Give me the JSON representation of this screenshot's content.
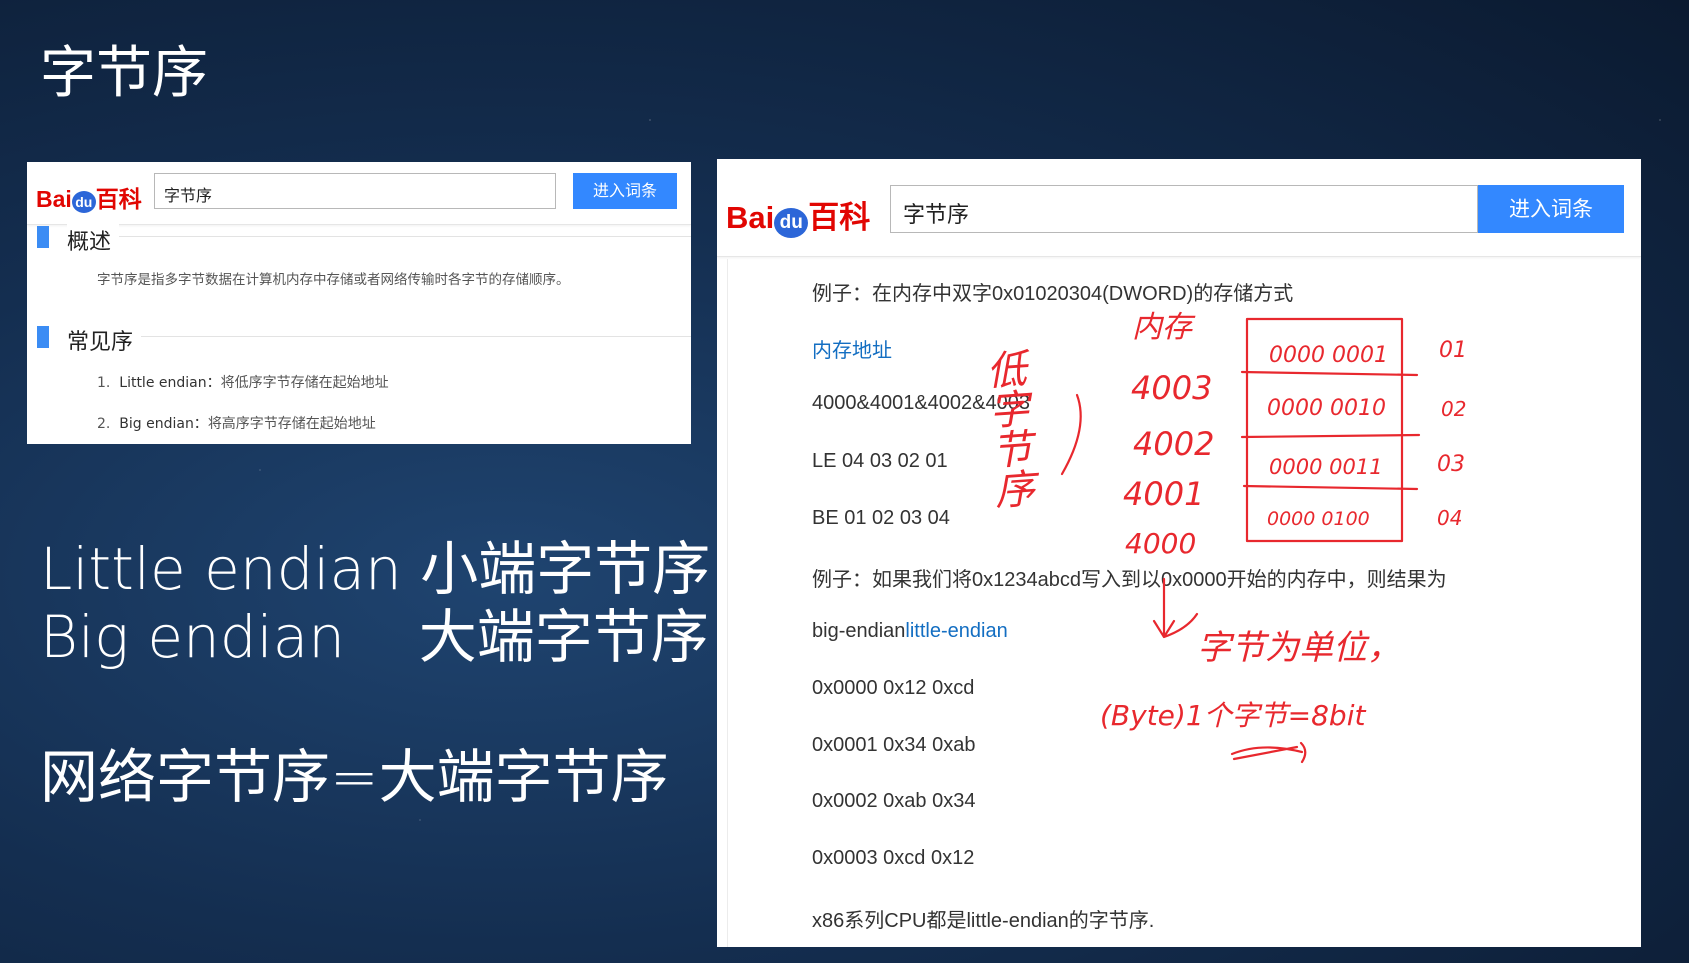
{
  "slide": {
    "title": "字节序",
    "line1": "Little endian 小端字节序",
    "line2": "Big endian    大端字节序",
    "line3": "网络字节序=大端字节序"
  },
  "brand": {
    "bai": "Bai",
    "du": "du",
    "baike": "百科",
    "red": "#e10602",
    "blue": "#3388ff"
  },
  "small_panel": {
    "search_value": "字节序",
    "enter_button": "进入词条",
    "overview_title": "概述",
    "overview_text": "字节序是指多字节数据在计算机内存中存储或者网络传输时各字节的存储顺序。",
    "common_title": "常见序",
    "items": [
      {
        "num": "1.",
        "name": "Little endian：",
        "desc": "将低序字节存储在起始地址"
      },
      {
        "num": "2.",
        "name": "Big endian：",
        "desc": "将高序字节存储在起始地址"
      }
    ]
  },
  "big_panel": {
    "search_value": "字节序",
    "enter_button": "进入词条",
    "rows": {
      "example1": "例子：在内存中双字0x01020304(DWORD)的存储方式",
      "mem_addr": "内存地址",
      "addrs": "4000&4001&4002&4003",
      "le": "LE 04 03 02 01",
      "be": "BE 01 02 03 04",
      "example2": "例子：如果我们将0x1234abcd写入到以0x0000开始的内存中，则结果为",
      "big_endian": "big-endian",
      "little_endian": "little-endian",
      "r0": "0x0000 0x12 0xcd",
      "r1": "0x0001 0x34 0xab",
      "r2": "0x0002 0xab 0x34",
      "r3": "0x0003 0xcd 0x12",
      "x86": "x86系列CPU都是little-endian的字节序."
    },
    "annotations": {
      "low_label": "低字节序",
      "memory": "内存",
      "addr_4003": "4003",
      "addr_4002": "4002",
      "addr_4001": "4001",
      "addr_4000": "4000",
      "bits_01": "0000 0001",
      "bits_02": "0000 0010",
      "bits_03": "0000 0011",
      "bits_04": "0000 0100",
      "hex_01": "01",
      "hex_02": "02",
      "hex_03": "03",
      "hex_04": "04",
      "unit": "字节为单位，",
      "byte_eq": "(Byte)1个字节=8bit"
    }
  }
}
